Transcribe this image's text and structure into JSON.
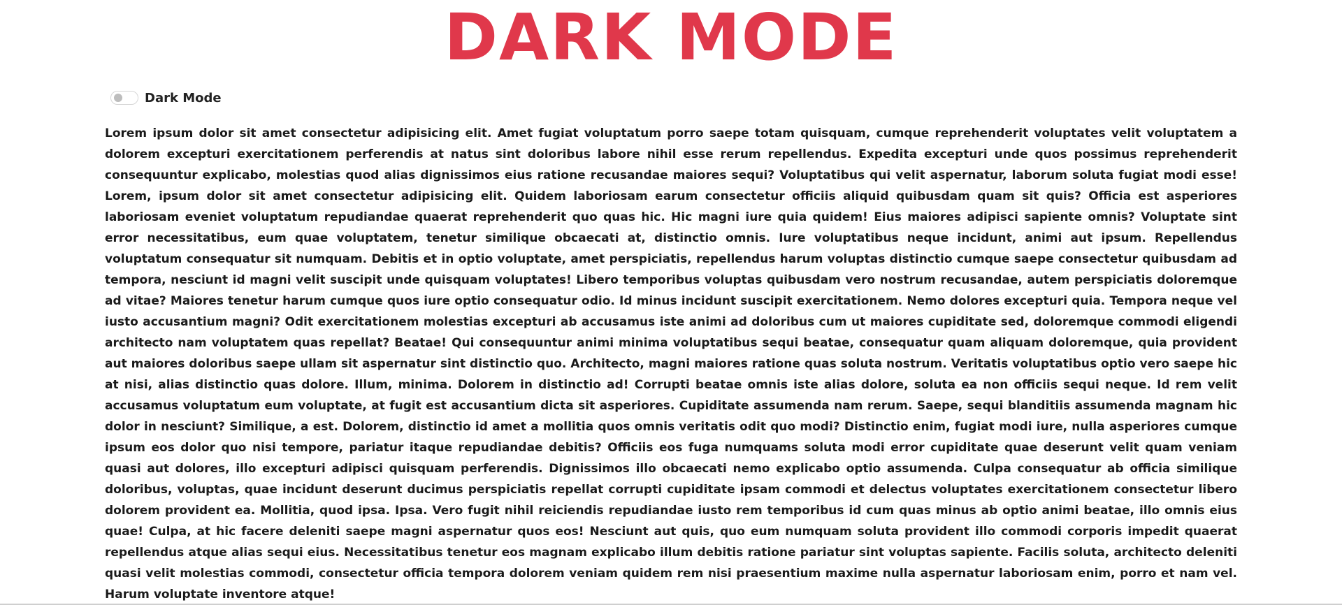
{
  "header": {
    "title": "DARK MODE"
  },
  "toggle": {
    "label": "Dark Mode",
    "checked": false
  },
  "content": {
    "paragraph": "Lorem ipsum dolor sit amet consectetur adipisicing elit. Amet fugiat voluptatum porro saepe totam quisquam, cumque reprehenderit voluptates velit voluptatem a dolorem excepturi exercitationem perferendis at natus sint doloribus labore nihil esse rerum repellendus. Expedita excepturi unde quos possimus reprehenderit consequuntur explicabo, molestias quod alias dignissimos eius ratione recusandae maiores sequi? Voluptatibus qui velit aspernatur, laborum soluta fugiat modi esse! Lorem, ipsum dolor sit amet consectetur adipisicing elit. Quidem laboriosam earum consectetur officiis aliquid quibusdam quam sit quis? Officia est asperiores laboriosam eveniet voluptatum repudiandae quaerat reprehenderit quo quas hic. Hic magni iure quia quidem! Eius maiores adipisci sapiente omnis? Voluptate sint error necessitatibus, eum quae voluptatem, tenetur similique obcaecati at, distinctio omnis. Iure voluptatibus neque incidunt, animi aut ipsum. Repellendus voluptatum consequatur sit numquam. Debitis et in optio voluptate, amet perspiciatis, repellendus harum voluptas distinctio cumque saepe consectetur quibusdam ad tempora, nesciunt id magni velit suscipit unde quisquam voluptates! Libero temporibus voluptas quibusdam vero nostrum recusandae, autem perspiciatis doloremque ad vitae? Maiores tenetur harum cumque quos iure optio consequatur odio. Id minus incidunt suscipit exercitationem. Nemo dolores excepturi quia. Tempora neque vel iusto accusantium magni? Odit exercitationem molestias excepturi ab accusamus iste animi ad doloribus cum ut maiores cupiditate sed, doloremque commodi eligendi architecto nam voluptatem quas repellat? Beatae! Qui consequuntur animi minima voluptatibus sequi beatae, consequatur quam aliquam doloremque, quia provident aut maiores doloribus saepe ullam sit aspernatur sint distinctio quo. Architecto, magni maiores ratione quas soluta nostrum. Veritatis voluptatibus optio vero saepe hic at nisi, alias distinctio quas dolore. Illum, minima. Dolorem in distinctio ad! Corrupti beatae omnis iste alias dolore, soluta ea non officiis sequi neque. Id rem velit accusamus voluptatum eum voluptate, at fugit est accusantium dicta sit asperiores. Cupiditate assumenda nam rerum. Saepe, sequi blanditiis assumenda magnam hic dolor in nesciunt? Similique, a est. Dolorem, distinctio id amet a mollitia quos omnis veritatis odit quo modi? Distinctio enim, fugiat modi iure, nulla asperiores cumque ipsum eos dolor quo nisi tempore, pariatur itaque repudiandae debitis? Officiis eos fuga numquams soluta modi error cupiditate quae deserunt velit quam veniam quasi aut dolores, illo excepturi adipisci quisquam perferendis. Dignissimos illo obcaecati nemo explicabo optio assumenda. Culpa consequatur ab officia similique doloribus, voluptas, quae incidunt deserunt ducimus perspiciatis repellat corrupti cupiditate ipsam commodi et delectus voluptates exercitationem consectetur libero dolorem provident ea. Mollitia, quod ipsa. Ipsa. Vero fugit nihil reiciendis repudiandae iusto rem temporibus id cum quas minus ab optio animi beatae, illo omnis eius quae! Culpa, at hic facere deleniti saepe magni aspernatur quos eos! Nesciunt aut quis, quo eum numquam soluta provident illo commodi corporis impedit quaerat repellendus atque alias sequi eius. Necessitatibus tenetur eos magnam explicabo illum debitis ratione pariatur sint voluptas sapiente. Facilis soluta, architecto deleniti quasi velit molestias commodi, consectetur officia tempora dolorem veniam quidem rem nisi praesentium maxime nulla aspernatur laboriosam enim, porro et nam vel. Harum voluptate inventore atque!"
  },
  "colors": {
    "accent": "#e0384b",
    "text": "#1a1a1a",
    "background": "#ffffff"
  }
}
